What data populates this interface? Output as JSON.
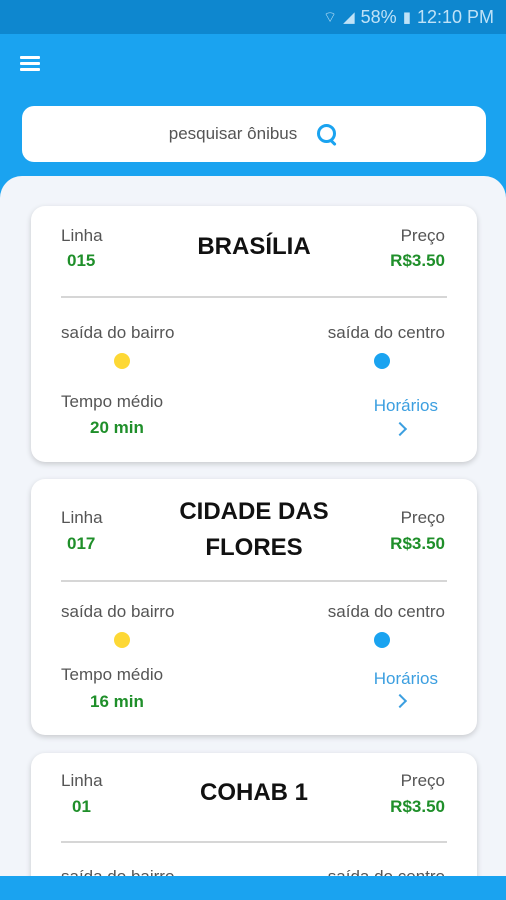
{
  "status_bar": {
    "battery": "58%",
    "time": "12:10 PM"
  },
  "search": {
    "placeholder": "pesquisar ônibus"
  },
  "labels": {
    "linha": "Linha",
    "preco": "Preço",
    "saida_bairro": "saída do bairro",
    "saida_centro": "saída do centro",
    "tempo_medio": "Tempo médio",
    "horarios": "Horários"
  },
  "colors": {
    "primary": "#1aa3f0",
    "bairro_dot": "#fdd835",
    "centro_dot": "#1aa3f0",
    "value_green": "#1f8f2a"
  },
  "cards": [
    {
      "line": "015",
      "name": "BRASÍLIA",
      "price": "R$3.50",
      "avg_time": "20 min"
    },
    {
      "line": "017",
      "name": "CIDADE DAS FLORES",
      "price": "R$3.50",
      "avg_time": "16 min"
    },
    {
      "line": "01",
      "name": "COHAB 1",
      "price": "R$3.50"
    }
  ]
}
